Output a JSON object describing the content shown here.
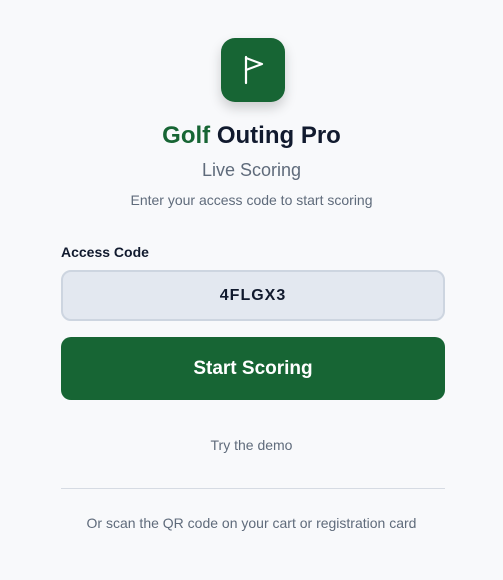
{
  "app": {
    "title_brand": "Golf",
    "title_rest": "Outing Pro",
    "subtitle": "Live Scoring",
    "instructions": "Enter your access code to start scoring",
    "logo_icon": "flag-icon"
  },
  "form": {
    "access_code_label": "Access Code",
    "access_code_value": "4FLGX3",
    "submit_label": "Start Scoring"
  },
  "footer": {
    "demo_link": "Try the demo",
    "qr_note": "Or scan the QR code on your cart or registration card"
  },
  "colors": {
    "brand": "#176534",
    "background": "#f8f9fb",
    "input_background": "#e3e8f0",
    "text_dark": "#111a2e",
    "text_muted": "#5f6b7b"
  }
}
